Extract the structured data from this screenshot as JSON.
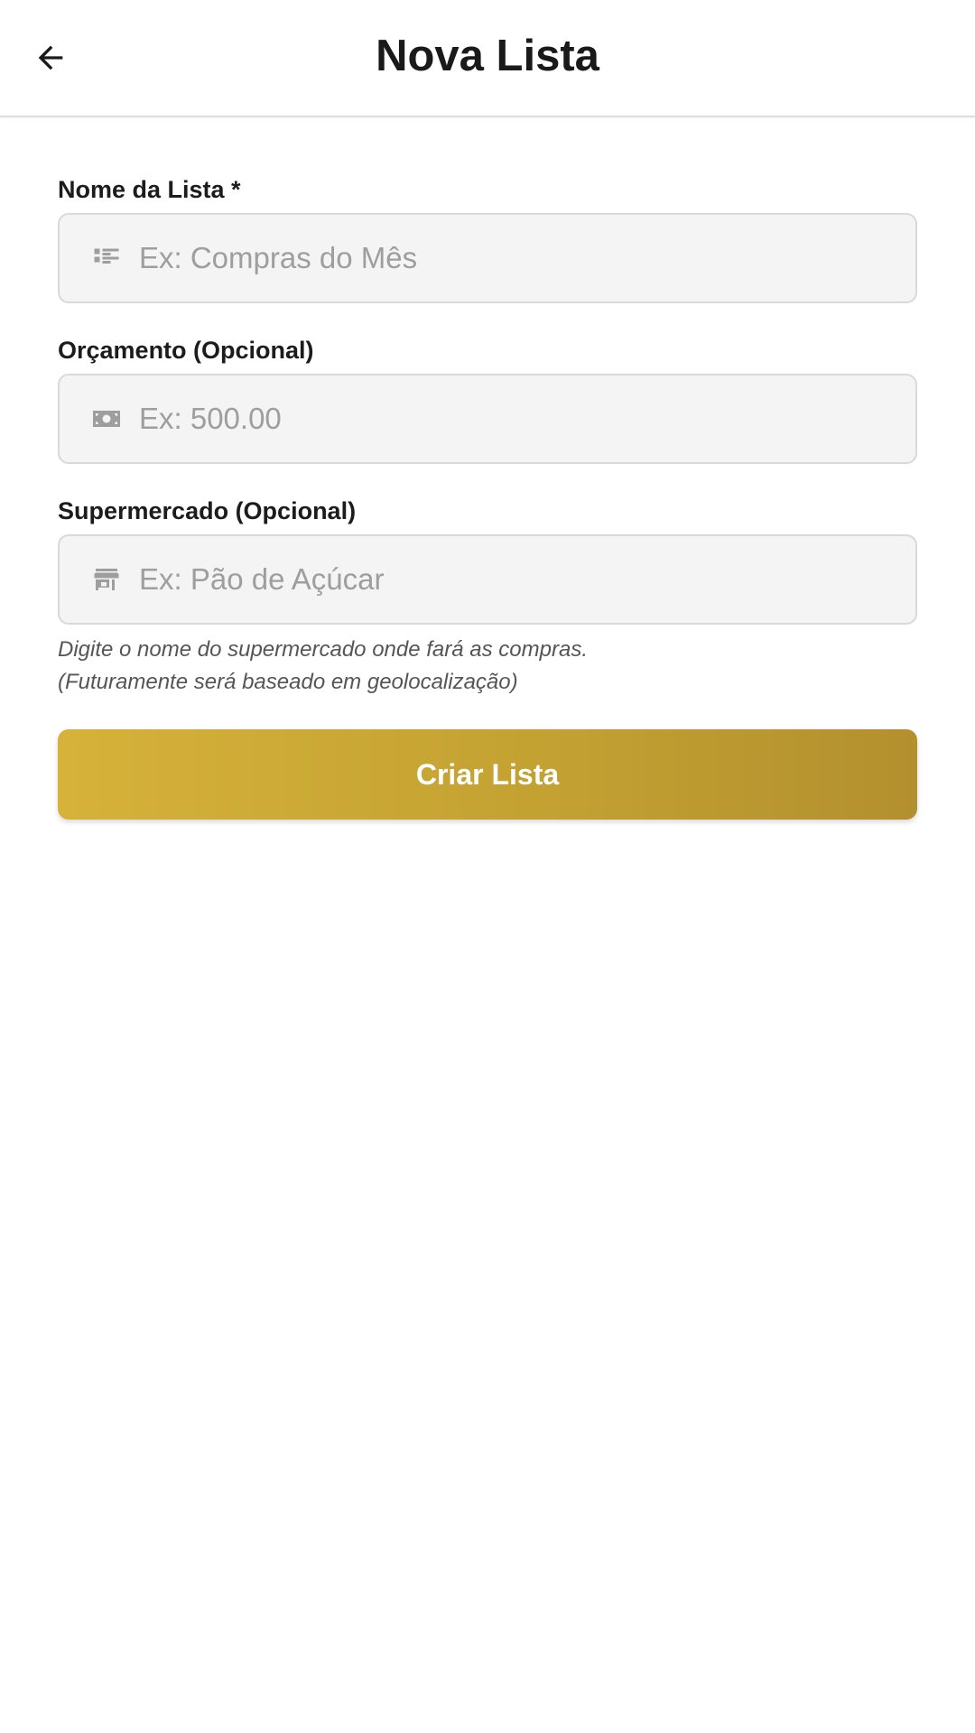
{
  "header": {
    "title": "Nova Lista",
    "back_icon": "arrow-back-icon"
  },
  "form": {
    "list_name": {
      "label": "Nome da Lista *",
      "placeholder": "Ex: Compras do Mês",
      "value": "",
      "icon": "list-icon"
    },
    "budget": {
      "label": "Orçamento (Opcional)",
      "placeholder": "Ex: 500.00",
      "value": "",
      "icon": "money-icon"
    },
    "supermarket": {
      "label": "Supermercado (Opcional)",
      "placeholder": "Ex: Pão de Açúcar",
      "value": "",
      "icon": "store-icon",
      "hint_line1": "Digite o nome do supermercado onde fará as compras.",
      "hint_line2": "(Futuramente será baseado em geolocalização)"
    },
    "submit_label": "Criar Lista"
  },
  "colors": {
    "accent_start": "#d6b23a",
    "accent_end": "#b3902e",
    "icon_gray": "#9e9e9e",
    "input_bg": "#f4f4f4"
  }
}
